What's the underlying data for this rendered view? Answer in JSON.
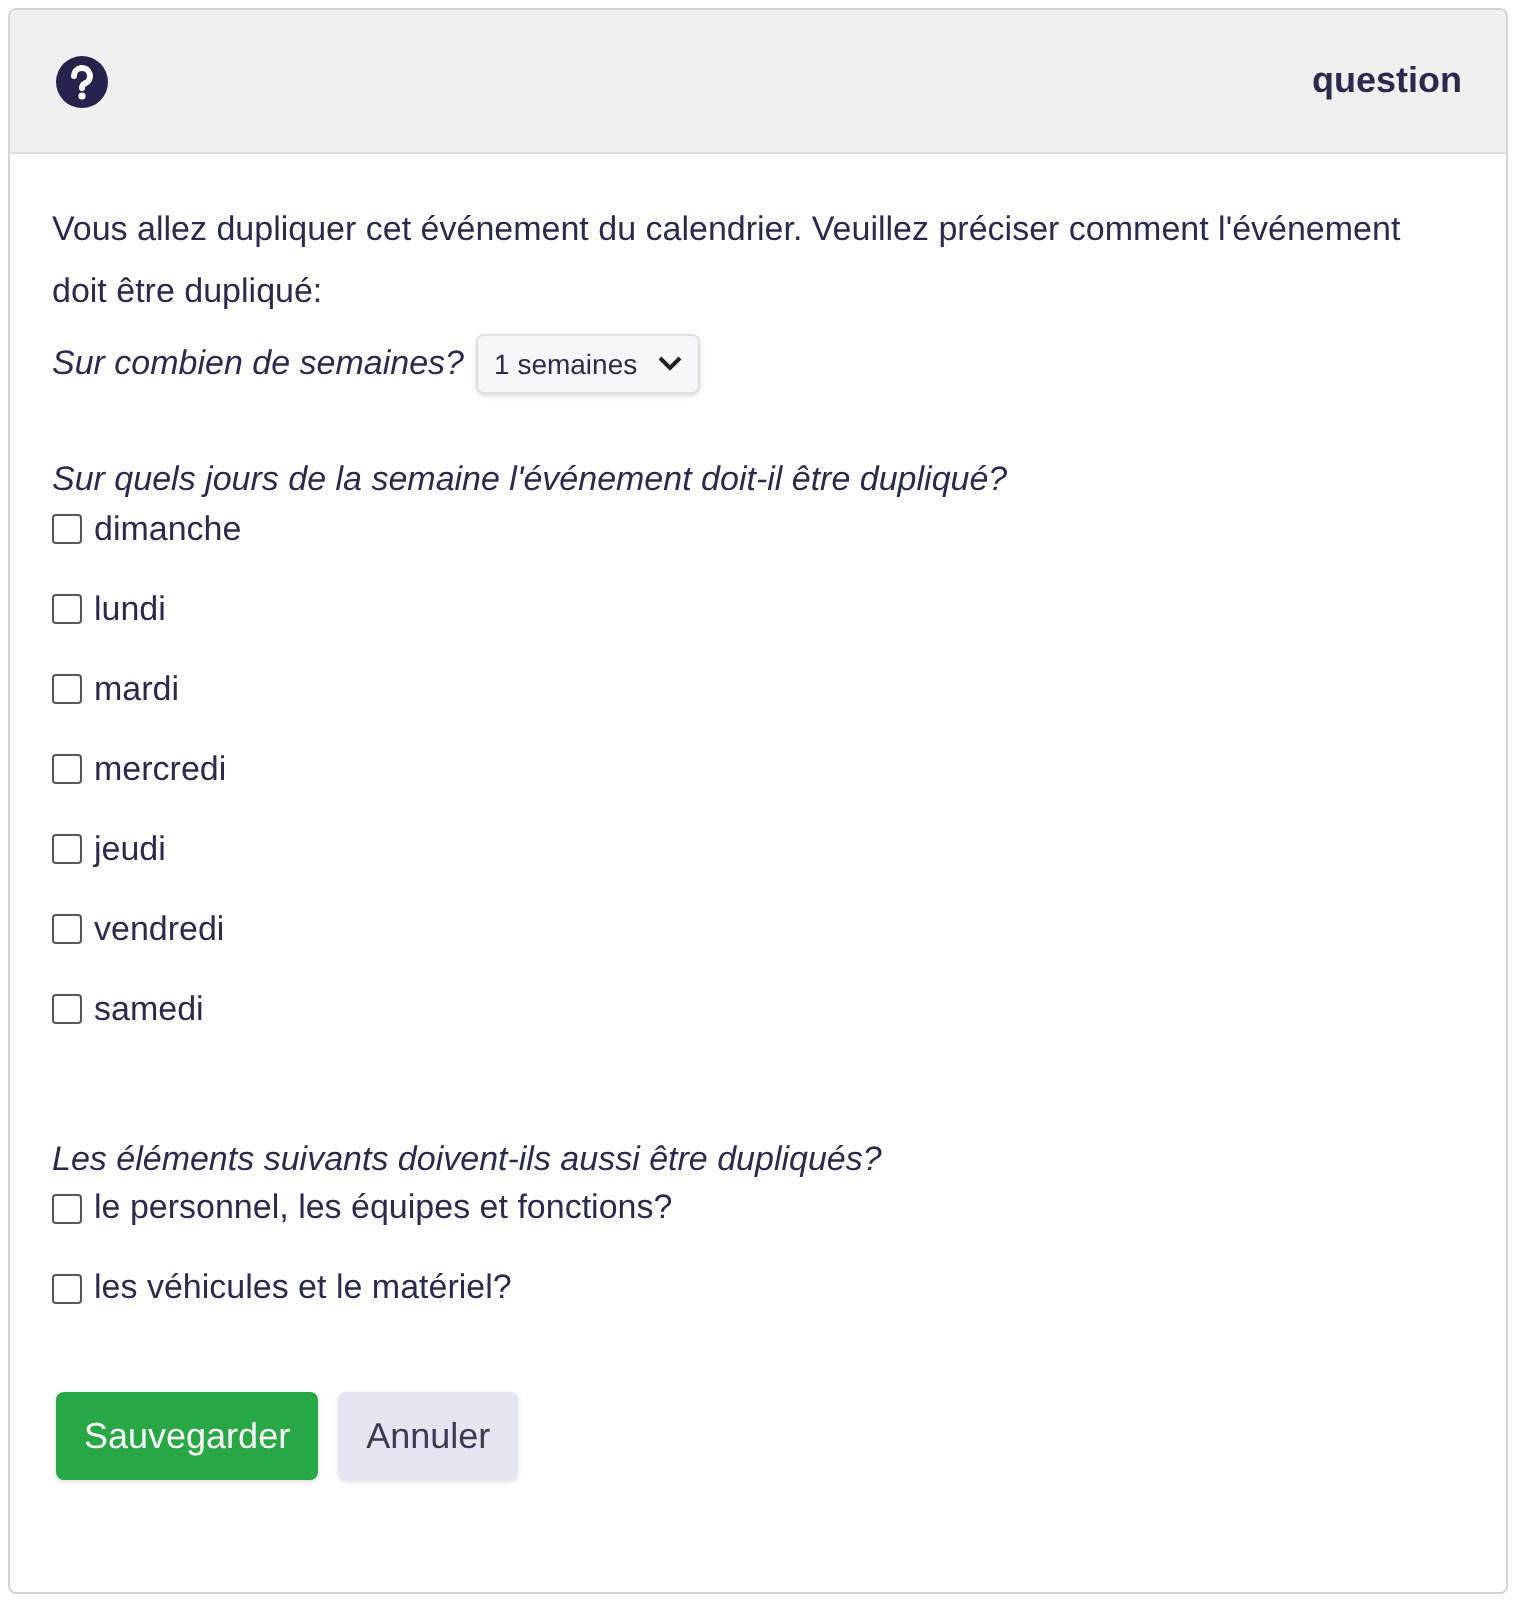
{
  "header": {
    "title": "question"
  },
  "intro": "Vous allez dupliquer cet événement du calendrier. Veuillez préciser comment l'événement doit être dupliqué:",
  "weeks": {
    "label": "Sur combien de semaines?",
    "value": "1 semaines"
  },
  "days": {
    "label": "Sur quels jours de la semaine l'événement doit-il être dupliqué?",
    "items": [
      {
        "label": "dimanche",
        "checked": false
      },
      {
        "label": "lundi",
        "checked": false
      },
      {
        "label": "mardi",
        "checked": false
      },
      {
        "label": "mercredi",
        "checked": false
      },
      {
        "label": "jeudi",
        "checked": false
      },
      {
        "label": "vendredi",
        "checked": false
      },
      {
        "label": "samedi",
        "checked": false
      }
    ]
  },
  "extras": {
    "label": "Les éléments suivants doivent-ils aussi être dupliqués?",
    "items": [
      {
        "label": "le personnel, les équipes et fonctions?",
        "checked": false
      },
      {
        "label": "les véhicules et le matériel?",
        "checked": false
      }
    ]
  },
  "buttons": [
    {
      "label": "Sauvegarder",
      "kind": "primary"
    },
    {
      "label": "Annuler",
      "kind": "secondary"
    }
  ]
}
